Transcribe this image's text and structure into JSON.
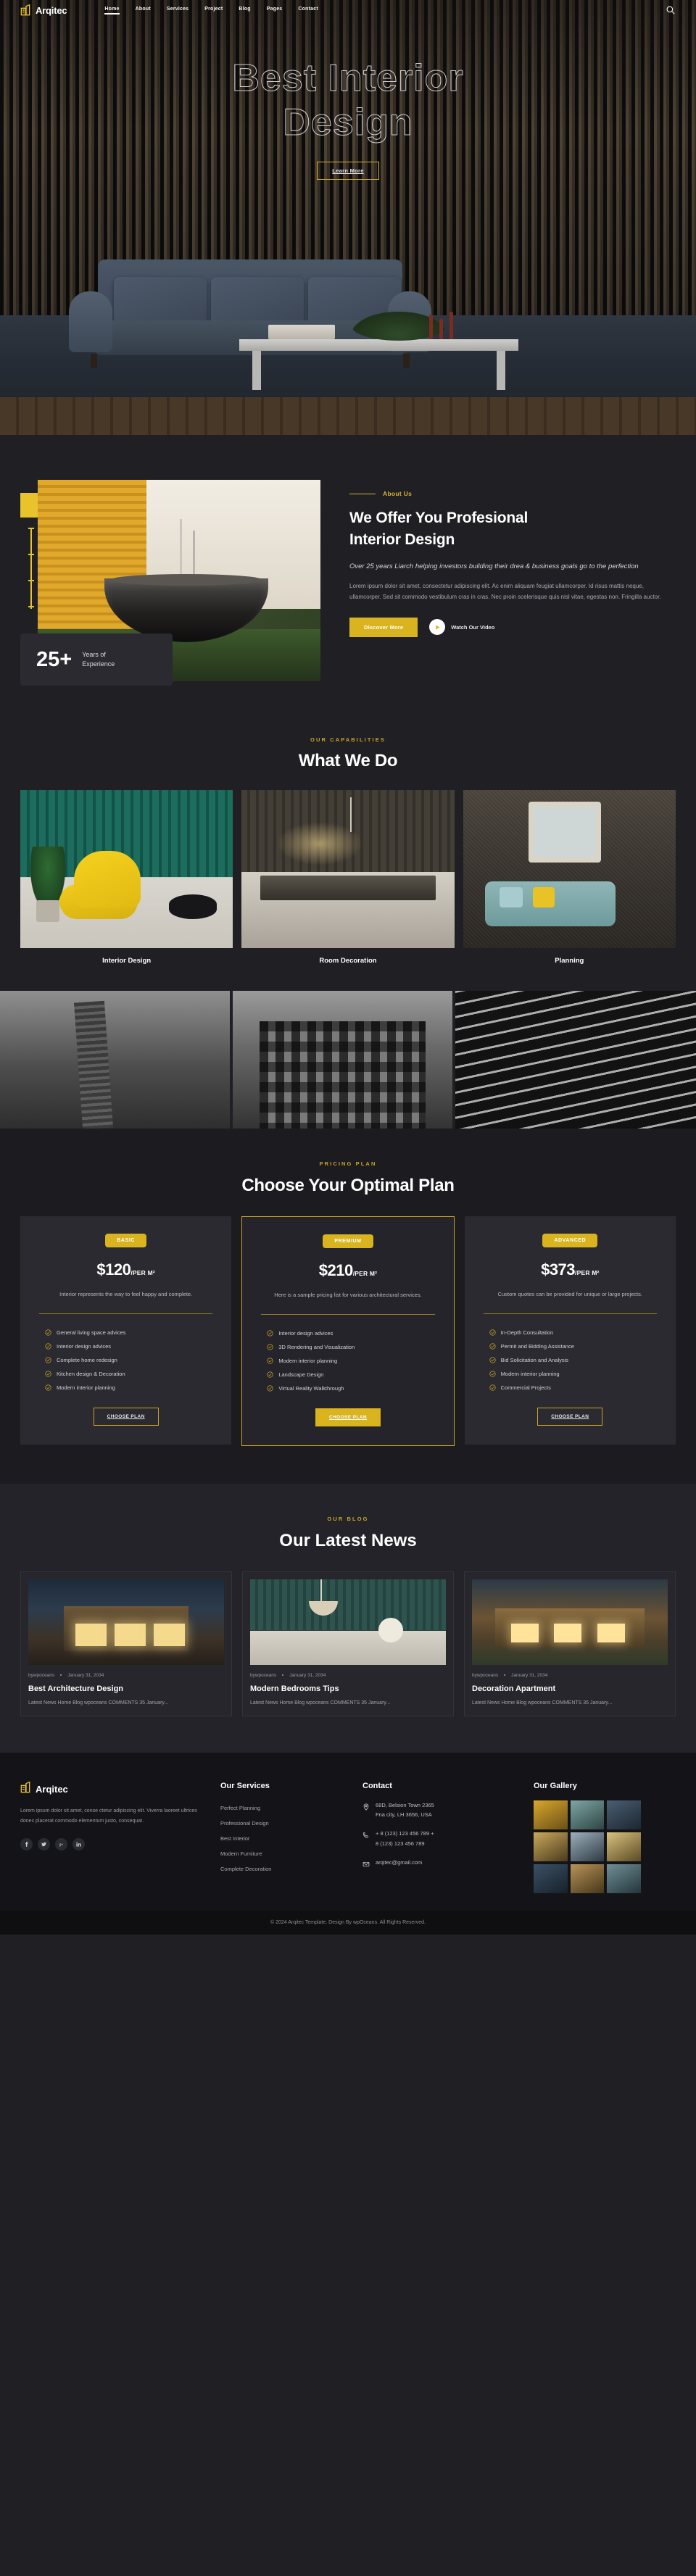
{
  "brand": {
    "name": "Arqitec",
    "accent": "#d9b41f",
    "logo_icon": "building-icon"
  },
  "nav": {
    "items": [
      {
        "label": "Home",
        "active": true
      },
      {
        "label": "About",
        "active": false
      },
      {
        "label": "Services",
        "active": false
      },
      {
        "label": "Project",
        "active": false
      },
      {
        "label": "Blog",
        "active": false
      },
      {
        "label": "Pages",
        "active": false
      },
      {
        "label": "Contact",
        "active": false
      }
    ],
    "search_icon": "search-icon"
  },
  "hero": {
    "title_line1": "Best Interior",
    "title_line2": "Design",
    "cta_label": "Learn More"
  },
  "about": {
    "eyebrow": "About Us",
    "heading_line1": "We Offer You Profesional",
    "heading_line2": "Interior Design",
    "subheading": "Over 25 years Liarch helping investors building their drea & business goals go to the perfection",
    "body": "Lorem ipsum dolor sit amet, consectetur adipiscing elit. Ac enim aliquam feugiat ullamcorper. Id risus mattis neque, ullamcorper. Sed sit commodo vestibulum cras in cras. Nec proin scelerisque quis nisl vitae, egestas non. Fringilla auctor.",
    "primary_cta": "Discover More",
    "video_cta": "Watch Our Video",
    "years_number": "25+",
    "years_label_line1": "Years of",
    "years_label_line2": "Experience"
  },
  "capabilities": {
    "eyebrow": "OUR CAPABILITIES",
    "title": "What We Do",
    "cards": [
      {
        "caption": "Interior Design"
      },
      {
        "caption": "Room Decoration"
      },
      {
        "caption": "Planning"
      }
    ]
  },
  "pricing": {
    "eyebrow": "PRICING PLAN",
    "title": "Choose Your Optimal Plan",
    "plans": [
      {
        "badge": "BASIC",
        "amount": "$120",
        "unit": "/PER M²",
        "description": "Interior represents the way to feel happy and complete.",
        "features": [
          "General living space advices",
          "Interior design advices",
          "Complete home redesign",
          "Kitchen design & Decoration",
          "Modern interior planning"
        ],
        "cta": "CHOOSE PLAN",
        "featured": false
      },
      {
        "badge": "PREMIUM",
        "amount": "$210",
        "unit": "/PER M²",
        "description": "Here is a sample pricing list for various architectural services.",
        "features": [
          "Interior design advices",
          "3D Rendering and Visualization",
          "Modern interior planning",
          "Landscape Design",
          "Virtual Reality Walkthrough"
        ],
        "cta": "CHOOSE PLAN",
        "featured": true
      },
      {
        "badge": "ADVANCED",
        "amount": "$373",
        "unit": "/PER M²",
        "description": "Custom quotes can be provided for unique or large projects.",
        "features": [
          "In-Depth Consultation",
          "Permit and Bidding Assistance",
          "Bid Solicitation and Analysis",
          "Modern interior planning",
          "Commercial Projects"
        ],
        "cta": "CHOOSE PLAN",
        "featured": false
      }
    ]
  },
  "blog": {
    "eyebrow": "OUR BLOG",
    "title": "Our Latest News",
    "posts": [
      {
        "author": "bywpoceans",
        "date": "January 31, 2034",
        "title": "Best Architecture Design",
        "excerpt": "Latest News Home Blog wpoceans COMMENTS 35 January..."
      },
      {
        "author": "bywpoceans",
        "date": "January 31, 2034",
        "title": "Modern Bedrooms Tips",
        "excerpt": "Latest News Home Blog wpoceans COMMENTS 35 January..."
      },
      {
        "author": "bywpoceans",
        "date": "January 31, 2034",
        "title": "Decoration Apartment",
        "excerpt": "Latest News Home Blog wpoceans COMMENTS 35 January..."
      }
    ]
  },
  "footer": {
    "brand": "Arqitec",
    "about": "Lorem ipsum dolor sit amet, conse ctetur adipiscing elit. Viverra laoreet ultrices donec placerat commodo elementum justo, consequat.",
    "socials": [
      {
        "name": "facebook-icon",
        "glyph": "f"
      },
      {
        "name": "twitter-icon",
        "glyph": "t"
      },
      {
        "name": "google-plus-icon",
        "glyph": "g+"
      },
      {
        "name": "linkedin-icon",
        "glyph": "in"
      }
    ],
    "services": {
      "heading": "Our Services",
      "items": [
        "Perfect Planning",
        "Professional Design",
        "Best Interior",
        "Modern Furniture",
        "Complete Decoration"
      ]
    },
    "contact": {
      "heading": "Contact",
      "address_line1": "68D, Belsion Town 2365",
      "address_line2": "Fna city, LH 3656, USA",
      "phone_line1": "+ 8 (123) 123 456 789 +",
      "phone_line2": "8 (123) 123 456 789",
      "email": "arqitec@gmail.com",
      "location_icon": "map-pin-icon",
      "phone_icon": "phone-icon",
      "email_icon": "envelope-icon"
    },
    "gallery": {
      "heading": "Our Gallery",
      "cells": 9
    },
    "copyright": "© 2024 Arqitec Template. Design By wpOceans. All Rights Reserved."
  }
}
